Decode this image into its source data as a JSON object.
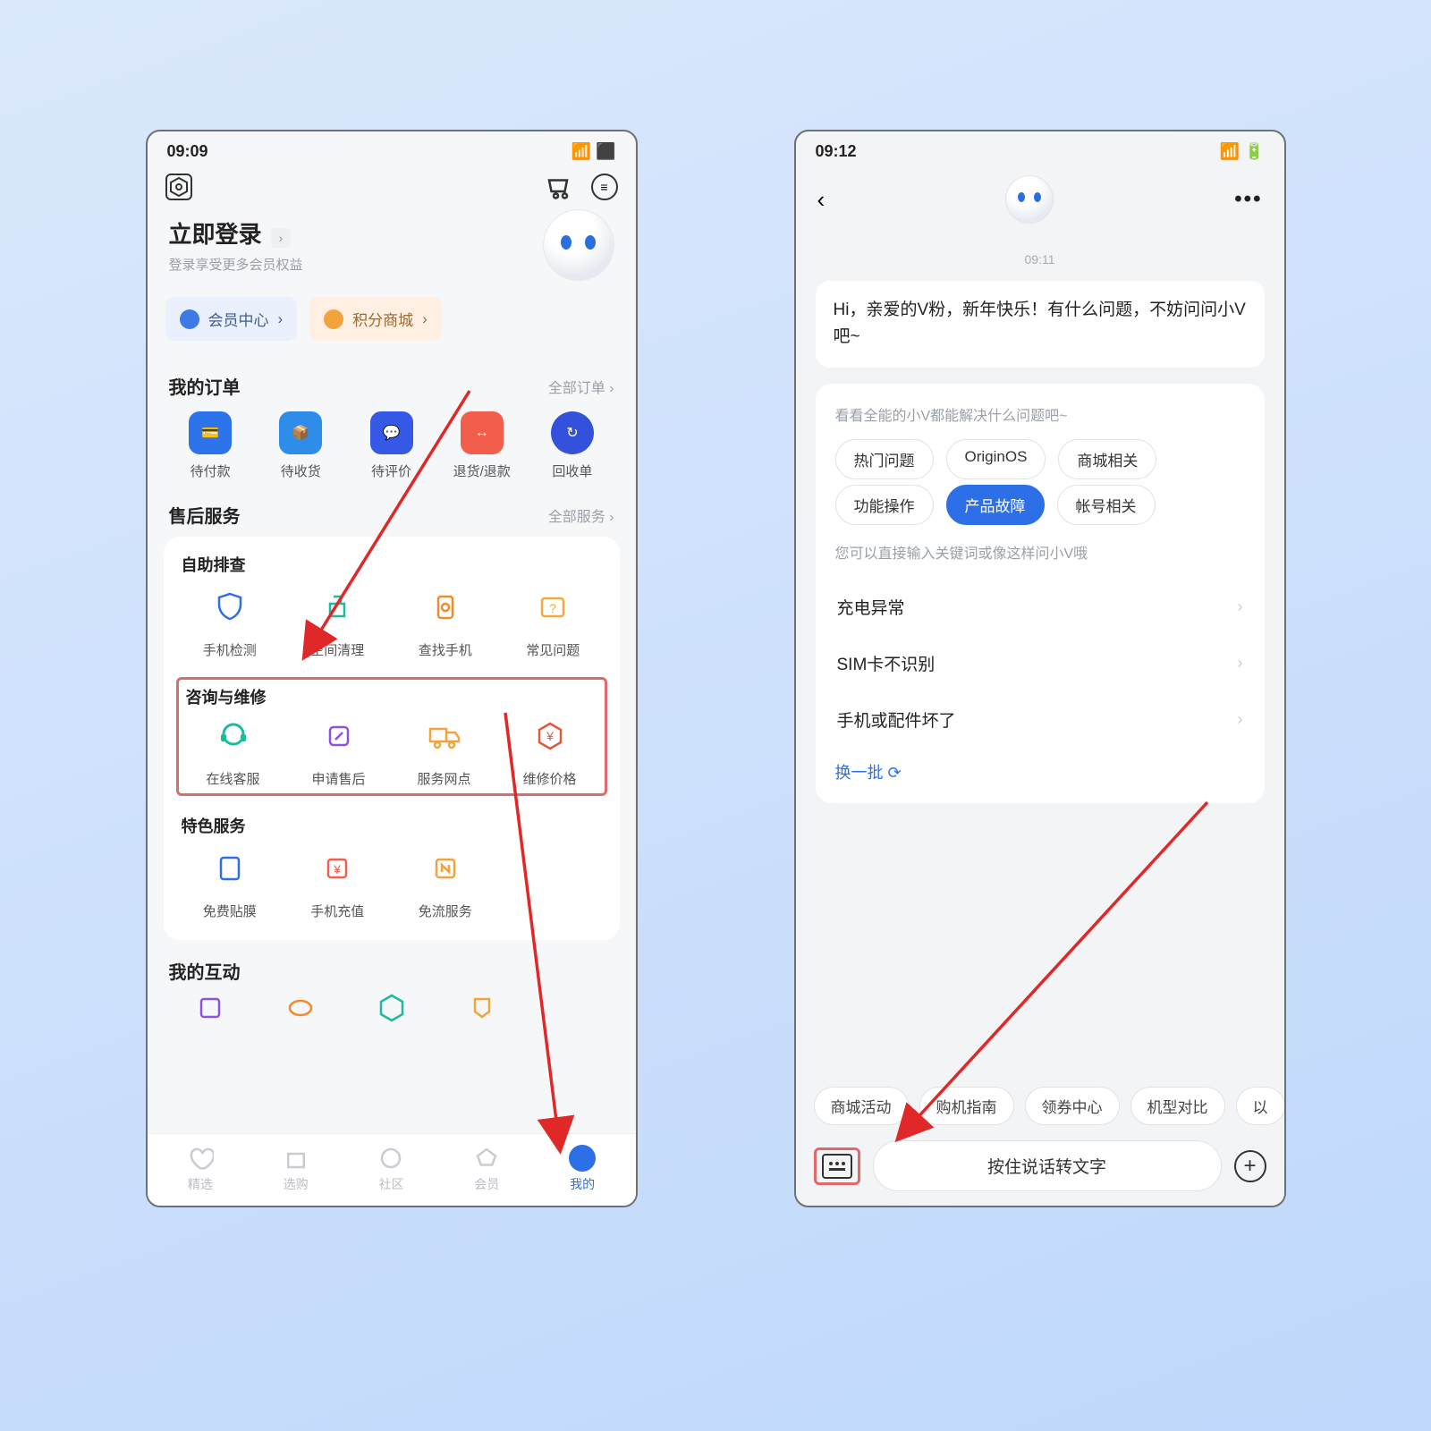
{
  "left": {
    "status_time": "09:09",
    "login_title": "立即登录",
    "login_sub": "登录享受更多会员权益",
    "chip_member": "会员中心",
    "chip_points": "积分商城",
    "orders_title": "我的订单",
    "orders_all": "全部订单",
    "orders": [
      "待付款",
      "待收货",
      "待评价",
      "退货/退款",
      "回收单"
    ],
    "service_title": "售后服务",
    "service_all": "全部服务",
    "self_check_title": "自助排查",
    "self_check": [
      "手机检测",
      "空间清理",
      "查找手机",
      "常见问题"
    ],
    "consult_title": "咨询与维修",
    "consult": [
      "在线客服",
      "申请售后",
      "服务网点",
      "维修价格"
    ],
    "special_title": "特色服务",
    "special": [
      "免费贴膜",
      "手机充值",
      "免流服务"
    ],
    "interaction_title": "我的互动",
    "tabs": [
      "精选",
      "选购",
      "社区",
      "会员",
      "我的"
    ]
  },
  "right": {
    "status_time": "09:12",
    "time_label": "09:11",
    "greeting": "Hi，亲爱的V粉，新年快乐！有什么问题，不妨问问小V吧~",
    "suggest_hint": "看看全能的小V都能解决什么问题吧~",
    "cats": [
      "热门问题",
      "OriginOS",
      "商城相关",
      "功能操作",
      "产品故障",
      "帐号相关"
    ],
    "cat_active_index": 4,
    "qhint": "您可以直接输入关键词或像这样问小V哦",
    "questions": [
      "充电异常",
      "SIM卡不识别",
      "手机或配件坏了"
    ],
    "refresh": "换一批",
    "quick": [
      "商城活动",
      "购机指南",
      "领券中心",
      "机型对比",
      "以"
    ],
    "talk_placeholder": "按住说话转文字"
  }
}
